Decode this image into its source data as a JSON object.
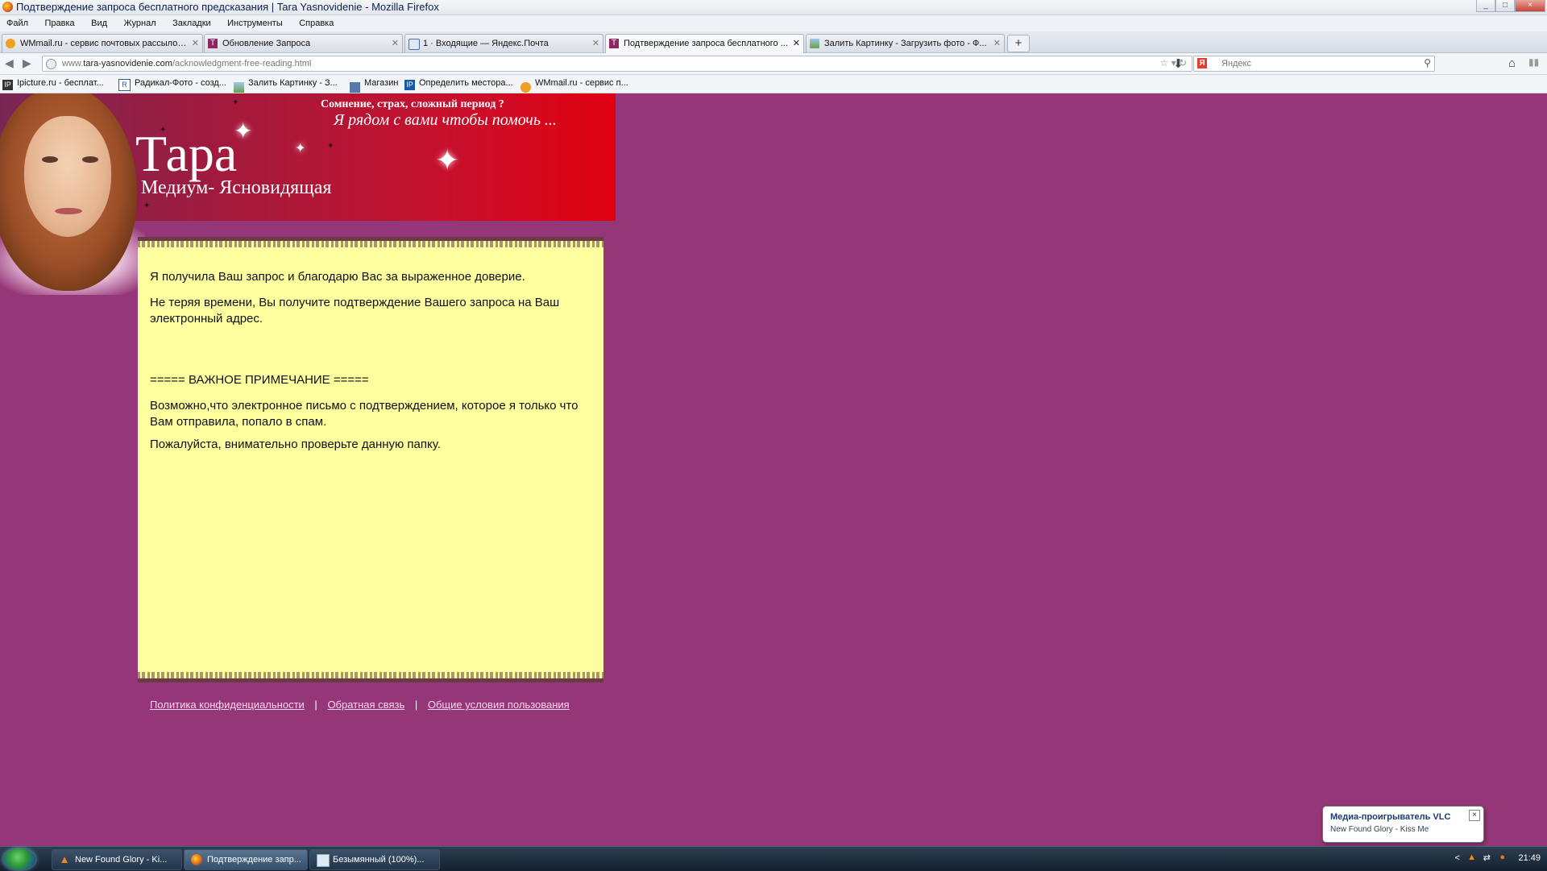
{
  "window": {
    "title": "Подтверждение запроса бесплатного предсказания | Tara Yasnovidenie - Mozilla Firefox",
    "controls": [
      "_",
      "□",
      "×"
    ]
  },
  "menu": [
    "Файл",
    "Правка",
    "Вид",
    "Журнал",
    "Закладки",
    "Инструменты",
    "Справка"
  ],
  "tabs": [
    {
      "label": "WMmail.ru - сервис почтовых рассылок...",
      "icon": "wmmail-icon"
    },
    {
      "label": "Обновление Запроса",
      "icon": "tara-icon"
    },
    {
      "label": "1 · Входящие — Яндекс.Почта",
      "icon": "mail-icon"
    },
    {
      "label": "Подтверждение запроса бесплатного ...",
      "icon": "tara-icon"
    },
    {
      "label": "Залить Картинку - Загрузить фото - Ф...",
      "icon": "image-icon"
    }
  ],
  "newtab": "+",
  "address": {
    "prefix": "www.",
    "domain": "tara-yasnovidenie.com",
    "path": "/acknowledgment-free-reading.html"
  },
  "search": {
    "placeholder": "Яндекс",
    "engine": "Я"
  },
  "bookmarks": [
    {
      "label": "Ipicture.ru - бесплат...",
      "icon": "IP"
    },
    {
      "label": "Радикал-Фото - созд...",
      "icon": "R"
    },
    {
      "label": "Залить Картинку - З...",
      "icon": "img"
    },
    {
      "label": "Магазин",
      "icon": "shop"
    },
    {
      "label": "Определить местора...",
      "icon": "IP"
    },
    {
      "label": "WMmail.ru - сервис п...",
      "icon": "wm"
    }
  ],
  "site": {
    "name": "Тара",
    "subtitle": "Медиум- Ясновидящая",
    "tagline1": "Сомнение, страх, сложный период ?",
    "tagline2": "Я рядом с вами чтобы помочь ..."
  },
  "content": {
    "p1": "Я получила Ваш запрос и благодарю Вас за выраженное доверие.",
    "p2": "Не теряя времени, Вы получите подтверждение Вашего запроса на Ваш электронный адрес.",
    "note_title": "===== ВАЖНОЕ ПРИМЕЧАНИЕ =====",
    "p3": "Возможно,что электронное письмо с подтверждением, которое я только что Вам отправила, попало в спам.",
    "p4": "Пожалуйста, внимательно проверьте данную папку."
  },
  "footer": {
    "privacy": "Политика конфиденциальности",
    "feedback": "Обратная связь",
    "terms": "Общие условия пользования",
    "separator": "|"
  },
  "taskbar": {
    "items": [
      {
        "label": "New Found Glory - Ki...",
        "icon": "vlc-icon"
      },
      {
        "label": "Подтверждение запр...",
        "icon": "firefox-icon"
      },
      {
        "label": "Безымянный (100%)...",
        "icon": "paint-icon"
      }
    ],
    "clock": "21:49",
    "tray_arrow": "<"
  },
  "notification": {
    "title": "Медиа-проигрыватель VLC",
    "message": "New Found Glory - Kiss Me",
    "close": "×"
  },
  "colors": {
    "page_bg": "#943677",
    "content_bg": "#ffffa0",
    "header_red": "#e00010"
  }
}
